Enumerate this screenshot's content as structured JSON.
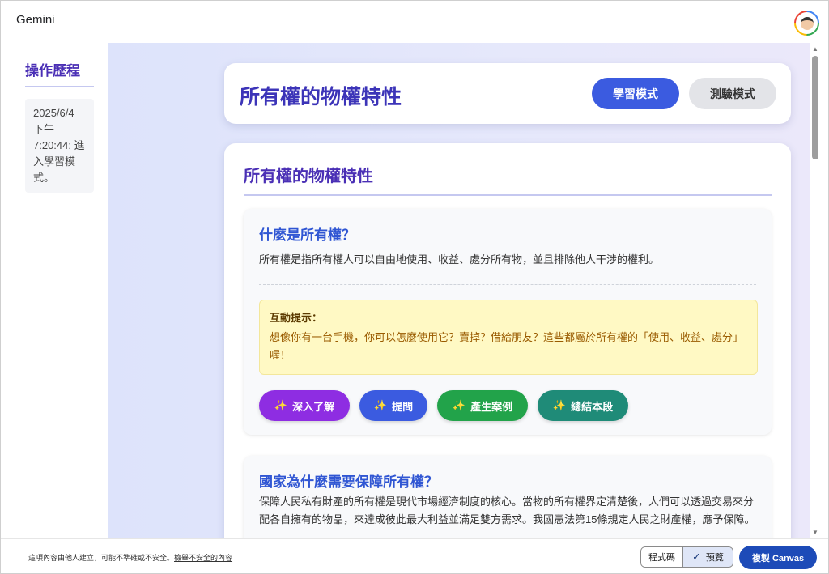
{
  "app": {
    "title": "Gemini"
  },
  "sidebar": {
    "heading": "操作歷程",
    "log": [
      {
        "text": "2025/6/4 下午 7:20:44: 進入學習模式。"
      }
    ]
  },
  "header": {
    "title": "所有權的物權特性",
    "learn_mode_label": "學習模式",
    "quiz_mode_label": "測驗模式"
  },
  "content": {
    "title": "所有權的物權特性",
    "sections": [
      {
        "title": "什麼是所有權？",
        "text": "所有權是指所有權人可以自由地使用、收益、處分所有物，並且排除他人干涉的權利。",
        "hint_label": "互動提示：",
        "hint_text": "想像你有一台手機，你可以怎麼使用它？賣掉？借給朋友？這些都屬於所有權的「使用、收益、處分」喔！",
        "actions": [
          {
            "label": "深入了解"
          },
          {
            "label": "提問"
          },
          {
            "label": "產生案例"
          },
          {
            "label": "總結本段"
          }
        ]
      },
      {
        "title": "國家為什麼需要保障所有權？",
        "text": "保障人民私有財產的所有權是現代市場經濟制度的核心。當物的所有權界定清楚後，人們可以透過交易來分配各自擁有的物品，來達成彼此最大利益並滿足雙方需求。我國憲法第15條規定人民之財產權，應予保障。"
      }
    ]
  },
  "footer": {
    "note": "這項內容由他人建立，可能不準確或不安全。",
    "report_link": "檢舉不安全的內容",
    "code_label": "程式碼",
    "preview_label": "預覽",
    "copy_label": "複製 Canvas"
  },
  "colors": {
    "accent_purple": "#4a2fb5",
    "accent_blue": "#3b5be0",
    "btn_purple": "#8e2de2",
    "btn_green": "#22a34a",
    "btn_teal": "#1f8b78",
    "hint_bg": "#fff9c4",
    "hint_text": "#9a5b00"
  },
  "icons": {
    "action": "sparkle-icon",
    "preview": "check-icon"
  }
}
